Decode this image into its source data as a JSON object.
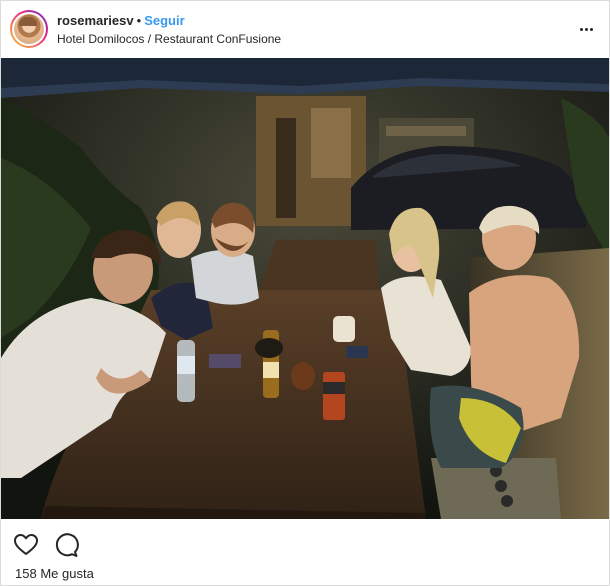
{
  "header": {
    "username": "rosemariesv",
    "separator": "•",
    "follow_label": "Seguir",
    "location": "Hotel Domilocos / Restaurant ConFusione",
    "avatar_icon": "profile-avatar",
    "more_icon": "more-options-icon"
  },
  "photo": {
    "scene": "night-group-photo"
  },
  "actions": {
    "like_icon": "heart-icon",
    "comment_icon": "comment-icon"
  },
  "likes": {
    "count": "158",
    "label": "Me gusta"
  },
  "colors": {
    "accent": "#3897f0",
    "text": "#262626",
    "border": "#dbdbdb"
  }
}
